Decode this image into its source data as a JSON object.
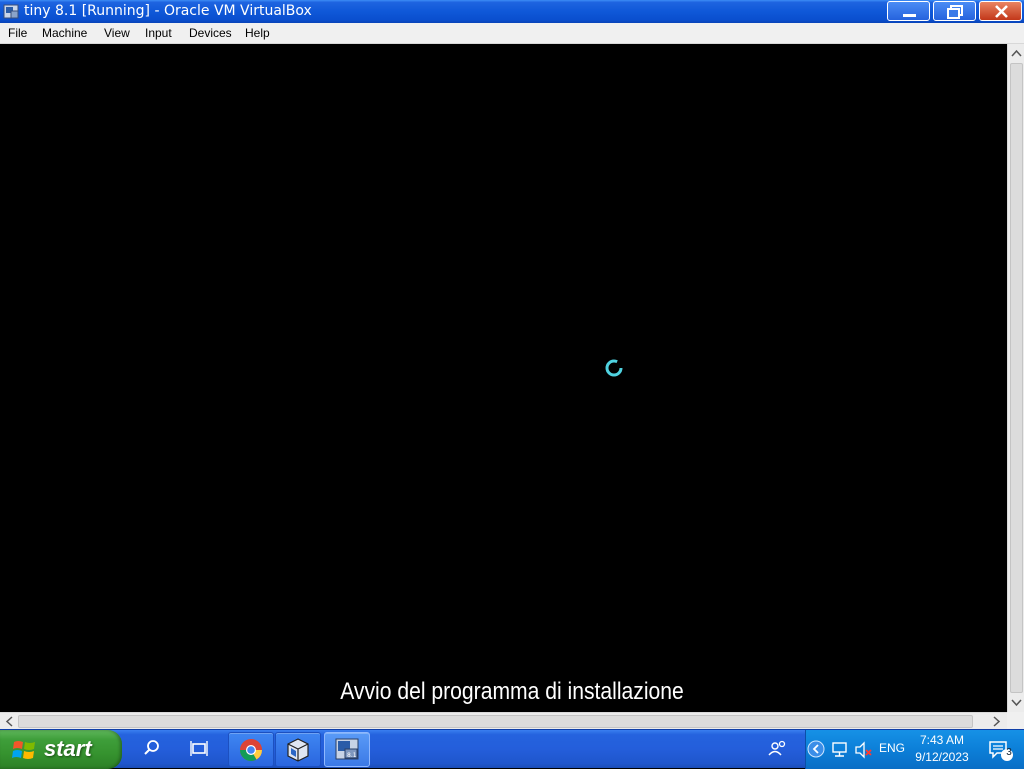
{
  "window": {
    "title": "tiny 8.1 [Running] - Oracle VM VirtualBox",
    "icons": {
      "app": "virtualbox-app-icon",
      "minimize": "minimize-icon",
      "maximize": "maximize-icon",
      "close": "close-icon"
    }
  },
  "menu": {
    "items": [
      {
        "label": "File"
      },
      {
        "label": "Machine"
      },
      {
        "label": "View"
      },
      {
        "label": "Input"
      },
      {
        "label": "Devices"
      },
      {
        "label": "Help"
      }
    ]
  },
  "vm_screen": {
    "status_text": "Avvio del programma di installazione",
    "spinner_icon": "loading-spinner-icon",
    "background": "#000000",
    "spinner_color": "#4fd2e0"
  },
  "taskbar": {
    "start_label": "start",
    "icons": [
      "search-icon",
      "task-view-icon",
      "chrome-icon",
      "virtualbox-icon",
      "vm-tiny81-icon"
    ],
    "tray": {
      "lang": "ENG",
      "time": "7:43 AM",
      "date": "9/12/2023",
      "notification_count": "3",
      "icons": [
        "people-icon",
        "show-hidden-icons",
        "network-icon",
        "volume-muted-icon",
        "notification-icon"
      ]
    },
    "colors": {
      "taskbar": "#245edb",
      "start": "#3e9e3a",
      "tray": "#0c7fd8"
    }
  }
}
